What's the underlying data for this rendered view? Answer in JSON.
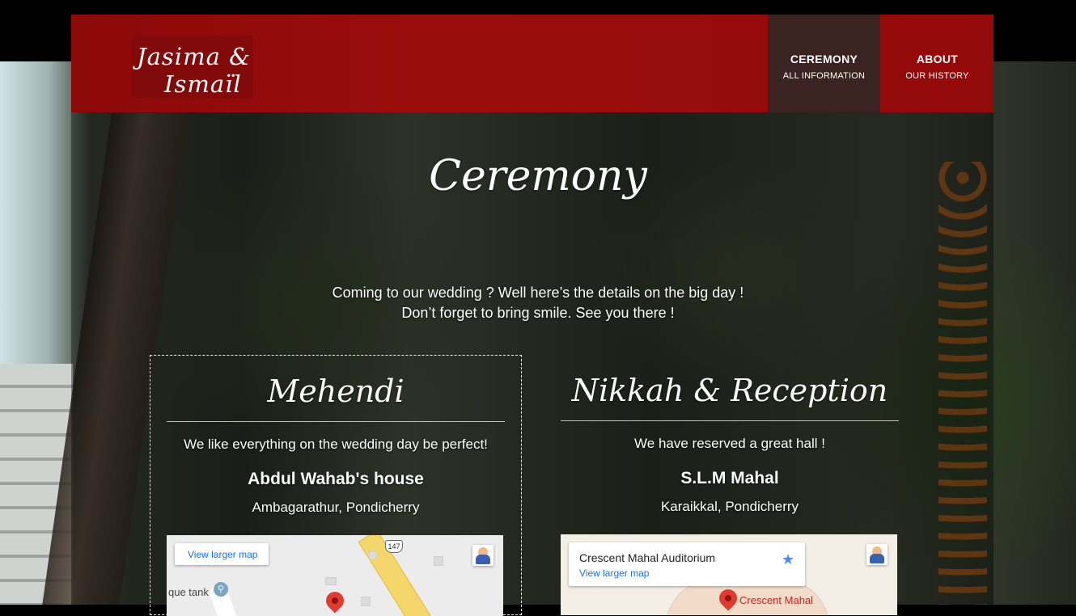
{
  "header": {
    "logo": {
      "line1": "Jasima &",
      "line2": "Ismaïl"
    },
    "nav": [
      {
        "label": "CEREMONY",
        "sublabel": "ALL INFORMATION",
        "active": true
      },
      {
        "label": "ABOUT",
        "sublabel": "OUR HISTORY",
        "active": false
      }
    ]
  },
  "page": {
    "title": "Ceremony",
    "intro_line1": "Coming to our wedding ? Well here’s the details on the big day !",
    "intro_line2": "Don’t forget to bring smile. See you there !"
  },
  "events": [
    {
      "title": "Mehendi",
      "tagline": "We like everything on the wedding day be perfect!",
      "venue": "Abdul Wahab's house",
      "address": "Ambagarathur, Pondicherry",
      "map": {
        "link_label": "View larger map",
        "route_shield": "147",
        "place_label": "que tank"
      }
    },
    {
      "title": "Nikkah & Reception",
      "tagline": "We have reserved a great hall !",
      "venue": "S.L.M Mahal",
      "address": "Karaikkal, Pondicherry",
      "map": {
        "place_name": "Crescent Mahal Auditorium",
        "link_label": "View larger map",
        "marker_label": "Crescent Mahal"
      }
    }
  ],
  "colors": {
    "header_red": "#930a0a",
    "nav_active": "#3a2320",
    "map_link": "#1a73e8",
    "pin_red": "#e03b2f"
  }
}
